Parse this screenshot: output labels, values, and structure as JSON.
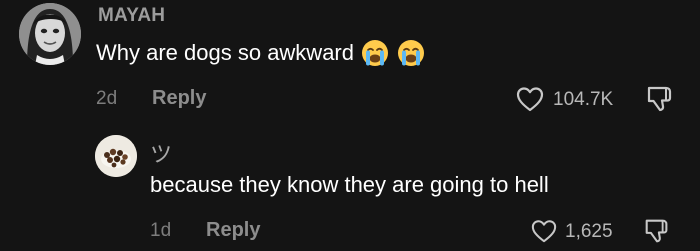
{
  "comment": {
    "username": "MAYAH",
    "text": "Why are dogs so awkward",
    "emojis": [
      "loudly-crying-face",
      "loudly-crying-face"
    ],
    "age": "2d",
    "reply_label": "Reply",
    "likes": "104.7K"
  },
  "reply": {
    "username": "ツ",
    "text": "because they know they are going to hell",
    "age": "1d",
    "reply_label": "Reply",
    "likes": "1,625"
  },
  "colors": {
    "background": "#141414",
    "text": "#ffffff",
    "muted": "#8d8d8d",
    "username": "#9c9c9c"
  }
}
